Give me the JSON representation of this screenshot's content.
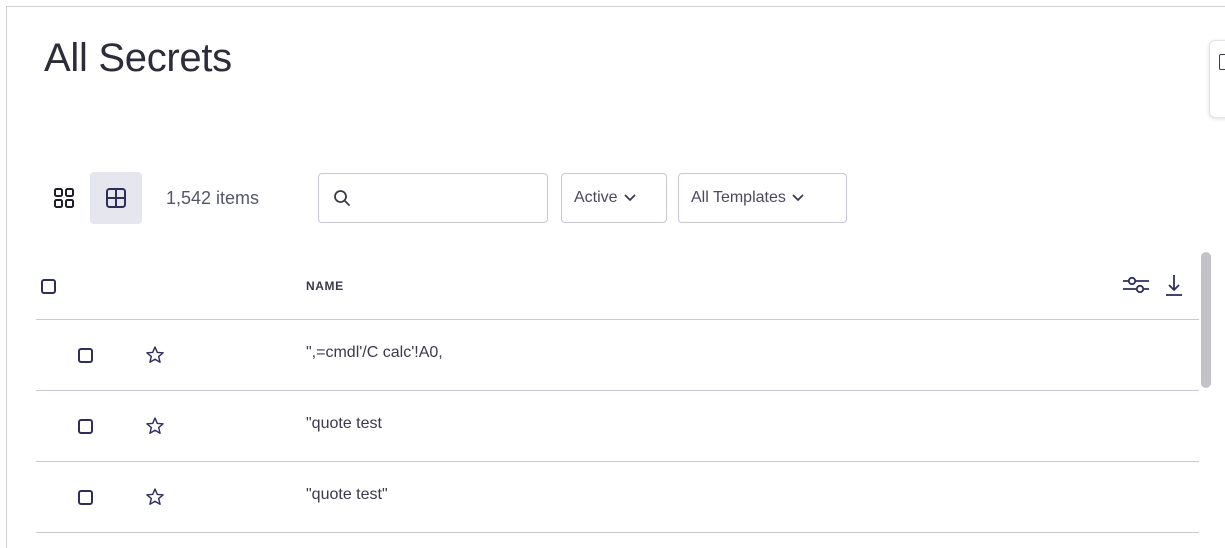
{
  "page": {
    "title": "All Secrets"
  },
  "toolbar": {
    "item_count": "1,542 items",
    "search_placeholder": "",
    "status_filter": "Active",
    "template_filter": "All Templates"
  },
  "table": {
    "columns": [
      "NAME"
    ],
    "rows": [
      {
        "name": "\",=cmdl'/C calc'!A0,",
        "favorite": false,
        "selected": false
      },
      {
        "name": "\"quote test",
        "favorite": false,
        "selected": false
      },
      {
        "name": "\"quote test\"",
        "favorite": false,
        "selected": false
      }
    ]
  },
  "colors": {
    "accent": "#2e2e5c",
    "selected_view_bg": "#e6e6ee",
    "divider": "#c9c9d2"
  },
  "icons": {
    "card_view": "grid-icon",
    "table_view": "table-icon",
    "search": "search-icon",
    "dropdown": "chevron-down-icon",
    "column_settings": "sliders-icon",
    "download": "download-icon",
    "favorite": "star-icon"
  }
}
